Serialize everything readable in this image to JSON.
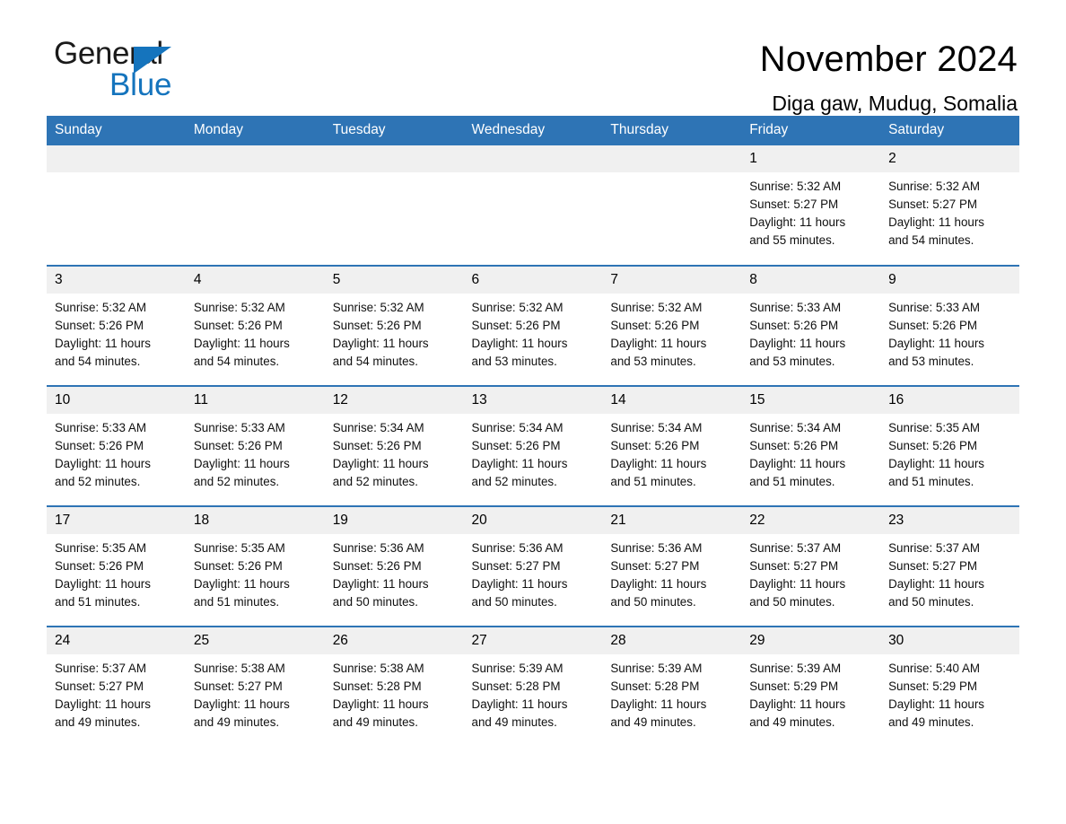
{
  "brand": {
    "name_part1": "General",
    "name_part2": "Blue",
    "triangle_color": "#1574bd",
    "accent_color": "#2e74b5"
  },
  "header": {
    "month_title": "November 2024",
    "location": "Diga gaw, Mudug, Somalia"
  },
  "weekday_headers": [
    "Sunday",
    "Monday",
    "Tuesday",
    "Wednesday",
    "Thursday",
    "Friday",
    "Saturday"
  ],
  "weeks": [
    [
      {
        "day": "",
        "sunrise": "",
        "sunset": "",
        "daylight_line1": "",
        "daylight_line2": ""
      },
      {
        "day": "",
        "sunrise": "",
        "sunset": "",
        "daylight_line1": "",
        "daylight_line2": ""
      },
      {
        "day": "",
        "sunrise": "",
        "sunset": "",
        "daylight_line1": "",
        "daylight_line2": ""
      },
      {
        "day": "",
        "sunrise": "",
        "sunset": "",
        "daylight_line1": "",
        "daylight_line2": ""
      },
      {
        "day": "",
        "sunrise": "",
        "sunset": "",
        "daylight_line1": "",
        "daylight_line2": ""
      },
      {
        "day": "1",
        "sunrise": "Sunrise: 5:32 AM",
        "sunset": "Sunset: 5:27 PM",
        "daylight_line1": "Daylight: 11 hours",
        "daylight_line2": "and 55 minutes."
      },
      {
        "day": "2",
        "sunrise": "Sunrise: 5:32 AM",
        "sunset": "Sunset: 5:27 PM",
        "daylight_line1": "Daylight: 11 hours",
        "daylight_line2": "and 54 minutes."
      }
    ],
    [
      {
        "day": "3",
        "sunrise": "Sunrise: 5:32 AM",
        "sunset": "Sunset: 5:26 PM",
        "daylight_line1": "Daylight: 11 hours",
        "daylight_line2": "and 54 minutes."
      },
      {
        "day": "4",
        "sunrise": "Sunrise: 5:32 AM",
        "sunset": "Sunset: 5:26 PM",
        "daylight_line1": "Daylight: 11 hours",
        "daylight_line2": "and 54 minutes."
      },
      {
        "day": "5",
        "sunrise": "Sunrise: 5:32 AM",
        "sunset": "Sunset: 5:26 PM",
        "daylight_line1": "Daylight: 11 hours",
        "daylight_line2": "and 54 minutes."
      },
      {
        "day": "6",
        "sunrise": "Sunrise: 5:32 AM",
        "sunset": "Sunset: 5:26 PM",
        "daylight_line1": "Daylight: 11 hours",
        "daylight_line2": "and 53 minutes."
      },
      {
        "day": "7",
        "sunrise": "Sunrise: 5:32 AM",
        "sunset": "Sunset: 5:26 PM",
        "daylight_line1": "Daylight: 11 hours",
        "daylight_line2": "and 53 minutes."
      },
      {
        "day": "8",
        "sunrise": "Sunrise: 5:33 AM",
        "sunset": "Sunset: 5:26 PM",
        "daylight_line1": "Daylight: 11 hours",
        "daylight_line2": "and 53 minutes."
      },
      {
        "day": "9",
        "sunrise": "Sunrise: 5:33 AM",
        "sunset": "Sunset: 5:26 PM",
        "daylight_line1": "Daylight: 11 hours",
        "daylight_line2": "and 53 minutes."
      }
    ],
    [
      {
        "day": "10",
        "sunrise": "Sunrise: 5:33 AM",
        "sunset": "Sunset: 5:26 PM",
        "daylight_line1": "Daylight: 11 hours",
        "daylight_line2": "and 52 minutes."
      },
      {
        "day": "11",
        "sunrise": "Sunrise: 5:33 AM",
        "sunset": "Sunset: 5:26 PM",
        "daylight_line1": "Daylight: 11 hours",
        "daylight_line2": "and 52 minutes."
      },
      {
        "day": "12",
        "sunrise": "Sunrise: 5:34 AM",
        "sunset": "Sunset: 5:26 PM",
        "daylight_line1": "Daylight: 11 hours",
        "daylight_line2": "and 52 minutes."
      },
      {
        "day": "13",
        "sunrise": "Sunrise: 5:34 AM",
        "sunset": "Sunset: 5:26 PM",
        "daylight_line1": "Daylight: 11 hours",
        "daylight_line2": "and 52 minutes."
      },
      {
        "day": "14",
        "sunrise": "Sunrise: 5:34 AM",
        "sunset": "Sunset: 5:26 PM",
        "daylight_line1": "Daylight: 11 hours",
        "daylight_line2": "and 51 minutes."
      },
      {
        "day": "15",
        "sunrise": "Sunrise: 5:34 AM",
        "sunset": "Sunset: 5:26 PM",
        "daylight_line1": "Daylight: 11 hours",
        "daylight_line2": "and 51 minutes."
      },
      {
        "day": "16",
        "sunrise": "Sunrise: 5:35 AM",
        "sunset": "Sunset: 5:26 PM",
        "daylight_line1": "Daylight: 11 hours",
        "daylight_line2": "and 51 minutes."
      }
    ],
    [
      {
        "day": "17",
        "sunrise": "Sunrise: 5:35 AM",
        "sunset": "Sunset: 5:26 PM",
        "daylight_line1": "Daylight: 11 hours",
        "daylight_line2": "and 51 minutes."
      },
      {
        "day": "18",
        "sunrise": "Sunrise: 5:35 AM",
        "sunset": "Sunset: 5:26 PM",
        "daylight_line1": "Daylight: 11 hours",
        "daylight_line2": "and 51 minutes."
      },
      {
        "day": "19",
        "sunrise": "Sunrise: 5:36 AM",
        "sunset": "Sunset: 5:26 PM",
        "daylight_line1": "Daylight: 11 hours",
        "daylight_line2": "and 50 minutes."
      },
      {
        "day": "20",
        "sunrise": "Sunrise: 5:36 AM",
        "sunset": "Sunset: 5:27 PM",
        "daylight_line1": "Daylight: 11 hours",
        "daylight_line2": "and 50 minutes."
      },
      {
        "day": "21",
        "sunrise": "Sunrise: 5:36 AM",
        "sunset": "Sunset: 5:27 PM",
        "daylight_line1": "Daylight: 11 hours",
        "daylight_line2": "and 50 minutes."
      },
      {
        "day": "22",
        "sunrise": "Sunrise: 5:37 AM",
        "sunset": "Sunset: 5:27 PM",
        "daylight_line1": "Daylight: 11 hours",
        "daylight_line2": "and 50 minutes."
      },
      {
        "day": "23",
        "sunrise": "Sunrise: 5:37 AM",
        "sunset": "Sunset: 5:27 PM",
        "daylight_line1": "Daylight: 11 hours",
        "daylight_line2": "and 50 minutes."
      }
    ],
    [
      {
        "day": "24",
        "sunrise": "Sunrise: 5:37 AM",
        "sunset": "Sunset: 5:27 PM",
        "daylight_line1": "Daylight: 11 hours",
        "daylight_line2": "and 49 minutes."
      },
      {
        "day": "25",
        "sunrise": "Sunrise: 5:38 AM",
        "sunset": "Sunset: 5:27 PM",
        "daylight_line1": "Daylight: 11 hours",
        "daylight_line2": "and 49 minutes."
      },
      {
        "day": "26",
        "sunrise": "Sunrise: 5:38 AM",
        "sunset": "Sunset: 5:28 PM",
        "daylight_line1": "Daylight: 11 hours",
        "daylight_line2": "and 49 minutes."
      },
      {
        "day": "27",
        "sunrise": "Sunrise: 5:39 AM",
        "sunset": "Sunset: 5:28 PM",
        "daylight_line1": "Daylight: 11 hours",
        "daylight_line2": "and 49 minutes."
      },
      {
        "day": "28",
        "sunrise": "Sunrise: 5:39 AM",
        "sunset": "Sunset: 5:28 PM",
        "daylight_line1": "Daylight: 11 hours",
        "daylight_line2": "and 49 minutes."
      },
      {
        "day": "29",
        "sunrise": "Sunrise: 5:39 AM",
        "sunset": "Sunset: 5:29 PM",
        "daylight_line1": "Daylight: 11 hours",
        "daylight_line2": "and 49 minutes."
      },
      {
        "day": "30",
        "sunrise": "Sunrise: 5:40 AM",
        "sunset": "Sunset: 5:29 PM",
        "daylight_line1": "Daylight: 11 hours",
        "daylight_line2": "and 49 minutes."
      }
    ]
  ]
}
